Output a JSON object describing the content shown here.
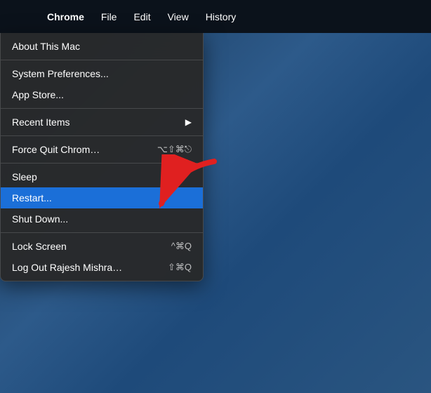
{
  "menubar": {
    "apple_symbol": "",
    "items": [
      {
        "label": "Chrome",
        "bold": true
      },
      {
        "label": "File"
      },
      {
        "label": "Edit"
      },
      {
        "label": "View"
      },
      {
        "label": "History"
      }
    ]
  },
  "apple_menu": {
    "items": [
      {
        "id": "about",
        "label": "About This Mac",
        "shortcut": "",
        "divider_after": true
      },
      {
        "id": "system-prefs",
        "label": "System Preferences...",
        "shortcut": ""
      },
      {
        "id": "app-store",
        "label": "App Store...",
        "shortcut": "",
        "divider_after": true
      },
      {
        "id": "recent-items",
        "label": "Recent Items",
        "has_arrow": true,
        "divider_after": true
      },
      {
        "id": "force-quit",
        "label": "Force Quit Chrom…",
        "shortcut": "⌥⇧⌘⎋",
        "divider_after": true
      },
      {
        "id": "sleep",
        "label": "Sleep",
        "shortcut": ""
      },
      {
        "id": "restart",
        "label": "Restart...",
        "shortcut": "",
        "highlighted": true
      },
      {
        "id": "shut-down",
        "label": "Shut Down...",
        "shortcut": "",
        "divider_after": true
      },
      {
        "id": "lock-screen",
        "label": "Lock Screen",
        "shortcut": "^⌘Q"
      },
      {
        "id": "log-out",
        "label": "Log Out Rajesh Mishra…",
        "shortcut": "⇧⌘Q"
      }
    ]
  }
}
